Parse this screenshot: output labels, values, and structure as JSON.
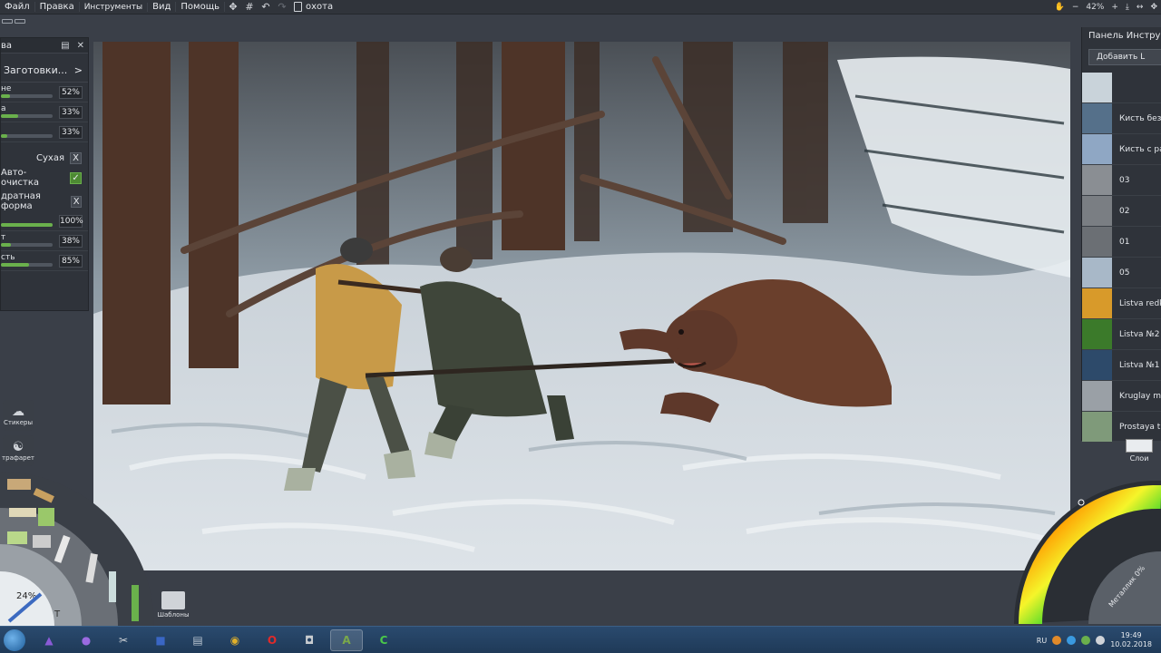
{
  "menubar": {
    "items": [
      "Файл",
      "Правка",
      "Инструменты",
      "Вид",
      "Помощь"
    ],
    "document_title": "охота",
    "zoom": "42%"
  },
  "brush_panel": {
    "title_fragment": "ва",
    "presets_label": "Заготовки...",
    "presets_arrow": ">",
    "sliders_top": [
      {
        "label": "не",
        "value": "52%",
        "fraction": 0.18
      },
      {
        "label": "а",
        "value": "33%",
        "fraction": 0.33
      },
      {
        "label": "",
        "value": "33%",
        "fraction": 0.12
      }
    ],
    "toggles": [
      {
        "label": "Сухая",
        "state": "X"
      },
      {
        "label": "Авто-очистка",
        "state": "✓"
      }
    ],
    "shape_label": "дратная форма",
    "shape_state": "X",
    "sliders_bottom": [
      {
        "label": "",
        "value": "100%",
        "fraction": 1.0
      },
      {
        "label": "т",
        "value": "38%",
        "fraction": 0.2
      },
      {
        "label": "сть",
        "value": "85%",
        "fraction": 0.55
      }
    ]
  },
  "tool_panel": {
    "title": "Панель Инструм",
    "add_button": "Добавить L",
    "brushes": [
      {
        "name": "",
        "color": "#c9d3da"
      },
      {
        "name": "Кисть без",
        "color": "#55708a"
      },
      {
        "name": "Кисть с ра",
        "color": "#8fa7c4"
      },
      {
        "name": "03",
        "color": "#8a8e93"
      },
      {
        "name": "02",
        "color": "#7a7e83"
      },
      {
        "name": "01",
        "color": "#6b6f74"
      },
      {
        "name": "05",
        "color": "#a8b8c8"
      },
      {
        "name": "Listva redk",
        "color": "#d89a2a"
      },
      {
        "name": "Listva №2",
        "color": "#3b7a2a"
      },
      {
        "name": "Listva №1",
        "color": "#2d4a6a"
      },
      {
        "name": "Kruglay m",
        "color": "#9aa0a6"
      },
      {
        "name": "Prostaya tr",
        "color": "#7f9a7a"
      }
    ]
  },
  "layers": {
    "label": "Слои"
  },
  "left_tools": {
    "stickers": "Стикеры",
    "stencil": "трафарет",
    "templates": "Шаблоны",
    "brush_size": "24%"
  },
  "color_wheel": {
    "metallic": "Металлик 0%"
  },
  "taskbar": {
    "lang": "RU",
    "time": "19:49",
    "date": "10.02.2018",
    "apps": [
      {
        "name": "purple-app",
        "color": "#8a5bd6",
        "glyph": "▲"
      },
      {
        "name": "microphone-app",
        "color": "#9a6ae0",
        "glyph": "●"
      },
      {
        "name": "paint-app",
        "color": "#d0d4d8",
        "glyph": "✂"
      },
      {
        "name": "save-app",
        "color": "#3a66c4",
        "glyph": "■"
      },
      {
        "name": "notepad-app",
        "color": "#b9c4d0",
        "glyph": "▤"
      },
      {
        "name": "chrome-app",
        "color": "#e0b02a",
        "glyph": "◉"
      },
      {
        "name": "opera-app",
        "color": "#e02a2a",
        "glyph": "O"
      },
      {
        "name": "camera-app",
        "color": "#c8ccd0",
        "glyph": "◘"
      },
      {
        "name": "artrage-app",
        "color": "#7aa84a",
        "glyph": "A"
      },
      {
        "name": "camtasia-app",
        "color": "#4ac84a",
        "glyph": "C"
      }
    ]
  }
}
